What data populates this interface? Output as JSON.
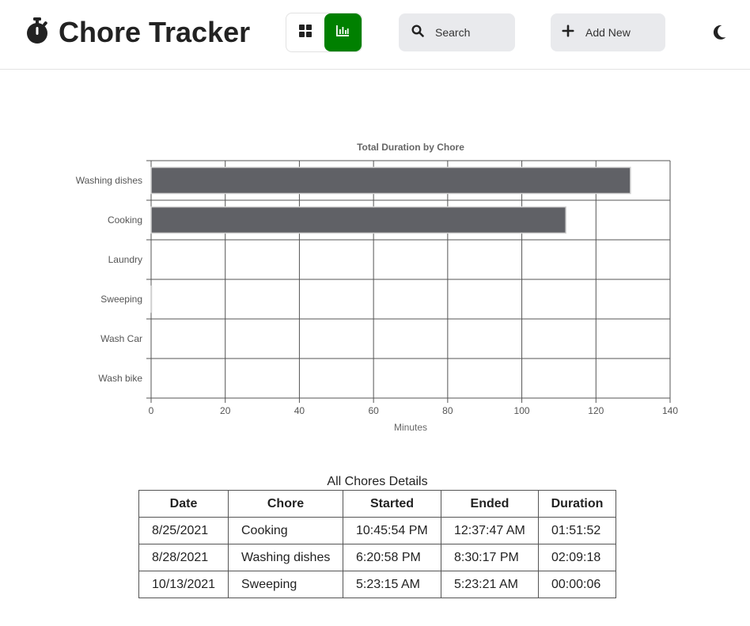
{
  "header": {
    "title": "Chore Tracker",
    "search_label": "Search",
    "add_label": "Add New",
    "active_view": "chart"
  },
  "icons": {
    "brand": "stopwatch-icon",
    "grid_view": "grid-icon",
    "chart_view": "bar-chart-icon",
    "search": "search-icon",
    "add": "plus-icon",
    "theme": "moon-icon"
  },
  "colors": {
    "accent": "#008000",
    "bar_fill": "#606166",
    "button_bg": "#e9eaed"
  },
  "chart_data": {
    "type": "bar",
    "orientation": "horizontal",
    "title": "Total Duration by Chore",
    "xlabel": "Minutes",
    "ylabel": "",
    "categories": [
      "Washing dishes",
      "Cooking",
      "Laundry",
      "Sweeping",
      "Wash Car",
      "Wash bike"
    ],
    "values": [
      129.3,
      111.87,
      0,
      0.1,
      0,
      0
    ],
    "xlim": [
      0,
      140
    ],
    "xticks": [
      0,
      20,
      40,
      60,
      80,
      100,
      120,
      140
    ],
    "grid": true,
    "legend": "none"
  },
  "table": {
    "caption": "All Chores Details",
    "columns": [
      "Date",
      "Chore",
      "Started",
      "Ended",
      "Duration"
    ],
    "rows": [
      [
        "8/25/2021",
        "Cooking",
        "10:45:54 PM",
        "12:37:47 AM",
        "01:51:52"
      ],
      [
        "8/28/2021",
        "Washing dishes",
        "6:20:58 PM",
        "8:30:17 PM",
        "02:09:18"
      ],
      [
        "10/13/2021",
        "Sweeping",
        "5:23:15 AM",
        "5:23:21 AM",
        "00:00:06"
      ]
    ]
  }
}
